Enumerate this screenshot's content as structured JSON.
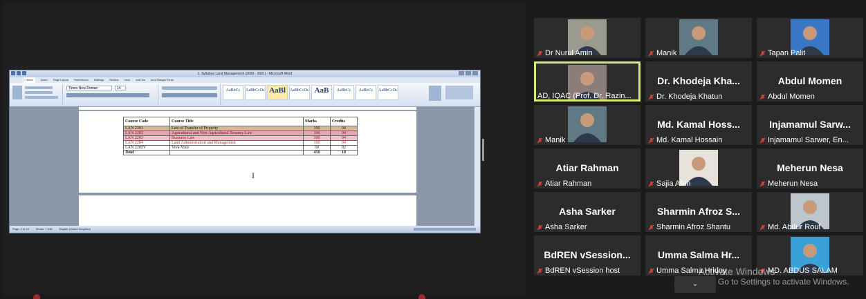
{
  "word": {
    "title": "1. Syllabus Land Management (2020 - 2021) - Microsoft Word",
    "tabs": [
      "Home",
      "Insert",
      "Page Layout",
      "References",
      "Mailings",
      "Review",
      "View",
      "Add-Ins",
      "Acro Bangla Fonts"
    ],
    "font_name": "Times New Roman",
    "font_size": "14",
    "styles": [
      "AaBbCc",
      "AaBbCcDc",
      "AaBl",
      "AaBbCcDc",
      "AaB",
      "AaBbCc",
      "AaBbCc",
      "AaBbCcDc"
    ],
    "status": [
      "Page: 2 of 15",
      "Words: 7,048",
      "English (United Kingdom)"
    ],
    "table": {
      "headers": [
        "Course Code",
        "Course Title",
        "Marks",
        "Credits"
      ],
      "rows": [
        [
          "LAN 2201",
          "Law of Transfer of Property",
          "100",
          "04"
        ],
        [
          "LAN 2202",
          "Agricultural and Non-Agricultural Tenancy Law",
          "100",
          "04"
        ],
        [
          "LAN 2203",
          "Business Law",
          "100",
          "04"
        ],
        [
          "LAN 2204",
          "Land Administration and Management",
          "100",
          "04"
        ],
        [
          "LAN 2205V",
          "Viva-Voce",
          "50",
          "02"
        ]
      ],
      "total": [
        "Total",
        "",
        "450",
        "18"
      ]
    },
    "page_number": "I"
  },
  "participants": [
    {
      "label": "Dr Nurul Amin",
      "bigname": "",
      "has_photo": true,
      "photo_bg": "#9a9a8e"
    },
    {
      "label": "Manik",
      "bigname": "",
      "has_photo": true,
      "photo_bg": "#5f7a84"
    },
    {
      "label": "Tapan Palit",
      "bigname": "",
      "has_photo": true,
      "photo_bg": "#3a77c4"
    },
    {
      "label": "AD, IQAC (Prof. Dr. Razin...",
      "bigname": "",
      "has_photo": true,
      "photo_bg": "#8a7d7a",
      "active": true
    },
    {
      "label": "Dr. Khodeja Khatun",
      "bigname": "Dr. Khodeja Kha...",
      "has_photo": false
    },
    {
      "label": "Abdul Momen",
      "bigname": "Abdul Momen",
      "has_photo": false
    },
    {
      "label": "Manik",
      "bigname": "",
      "has_photo": true,
      "photo_bg": "#5f7a84"
    },
    {
      "label": "Md. Kamal Hossain",
      "bigname": "Md. Kamal Hoss...",
      "has_photo": false
    },
    {
      "label": "Injamamul Sarwer, En...",
      "bigname": "Injamamul Sarw...",
      "has_photo": false
    },
    {
      "label": "Atiar Rahman",
      "bigname": "Atiar Rahman",
      "has_photo": false
    },
    {
      "label": "Sajia Afrin",
      "bigname": "",
      "has_photo": true,
      "photo_bg": "#e8e2dc"
    },
    {
      "label": "Meherun Nesa",
      "bigname": "Meherun Nesa",
      "has_photo": false
    },
    {
      "label": "Asha Sarker",
      "bigname": "Asha Sarker",
      "has_photo": false
    },
    {
      "label": "Sharmin Afroz Shantu",
      "bigname": "Sharmin Afroz S...",
      "has_photo": false
    },
    {
      "label": "Md. Abdur Rouf",
      "bigname": "",
      "has_photo": true,
      "photo_bg": "#bcc6cc"
    },
    {
      "label": "BdREN vSession host",
      "bigname": "BdREN vSession...",
      "has_photo": false
    },
    {
      "label": "Umma Salma Hridoy",
      "bigname": "Umma Salma Hr...",
      "has_photo": false
    },
    {
      "label": "MD. ABDUS SALAM",
      "bigname": "",
      "has_photo": true,
      "photo_bg": "#3aa0d8"
    }
  ],
  "watermark": {
    "line1": "Activate Windows",
    "line2": "Go to Settings to activate Windows."
  },
  "gallery_toggle": "⌄",
  "colors": {
    "mic_muted": "#e0453a",
    "active_border": "#d9e87a"
  }
}
